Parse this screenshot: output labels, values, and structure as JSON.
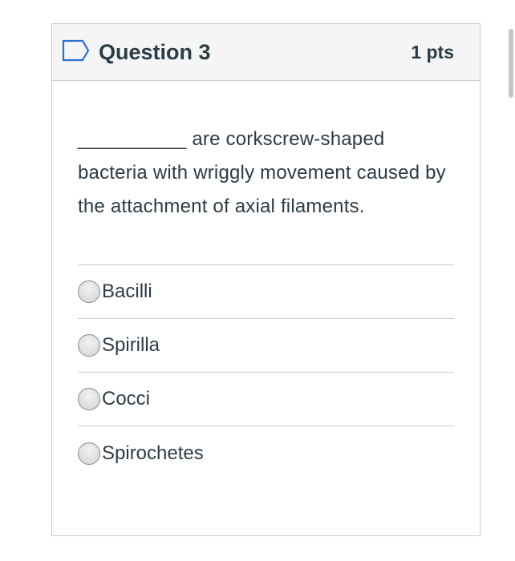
{
  "question": {
    "title": "Question 3",
    "points": "1 pts",
    "flag_icon": "flag-outline-icon",
    "text": "__________ are corkscrew-shaped bacteria with wriggly movement caused by the attachment of axial filaments.",
    "answers": [
      {
        "label": "Bacilli",
        "selected": false
      },
      {
        "label": "Spirilla",
        "selected": false
      },
      {
        "label": "Cocci",
        "selected": false
      },
      {
        "label": "Spirochetes",
        "selected": false
      }
    ]
  },
  "colors": {
    "text": "#2d3b45",
    "header_bg": "#f5f5f5",
    "border": "#c7cdd1",
    "flag": "#2b6fd6"
  }
}
